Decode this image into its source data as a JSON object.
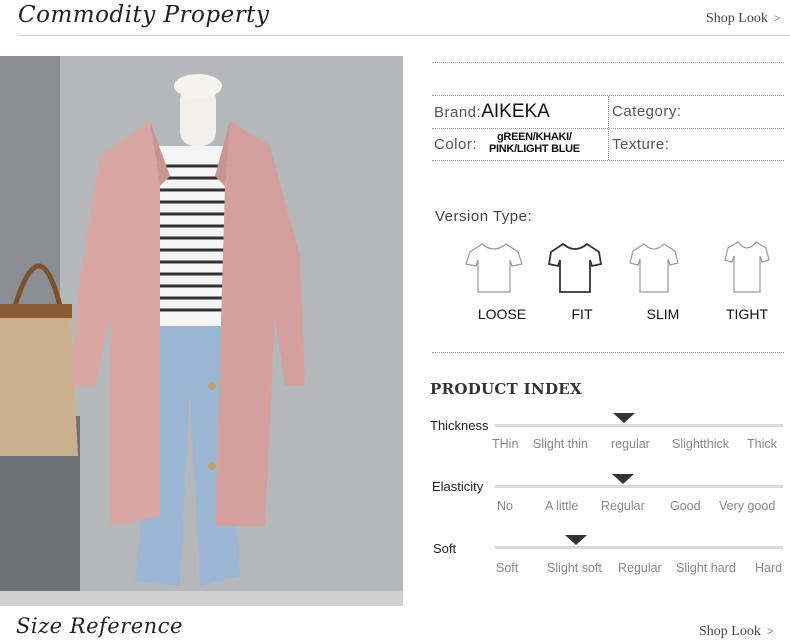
{
  "header": {
    "title": "Commodity Property",
    "shop_look": "Shop Look",
    "chevron": ">"
  },
  "footer": {
    "title": "Size Reference",
    "shop_look": "Shop Look",
    "chevron": ">"
  },
  "specs": {
    "brand_label": "Brand:",
    "brand_value": "AIKEKA",
    "category_label": "Category:",
    "color_label": "Color:",
    "color_value_line1": "gREEN/KHAKI/",
    "color_value_line2": "PINK/LIGHT BLUE",
    "texture_label": "Texture:"
  },
  "version": {
    "title": "Version Type:",
    "types": [
      "LOOSE",
      "FIT",
      "SLIM",
      "TIGHT"
    ],
    "selected": "FIT"
  },
  "product_index": {
    "title": "PRODUCT INDEX",
    "metrics": [
      {
        "label": "Thickness",
        "scale": [
          "THin",
          "Slight thin",
          "regular",
          "Slightthick",
          "Thick"
        ],
        "selected": "regular"
      },
      {
        "label": "Elasticity",
        "scale": [
          "No",
          "A little",
          "Regular",
          "Good",
          "Very good"
        ],
        "selected": "Regular"
      },
      {
        "label": "Soft",
        "scale": [
          "Soft",
          "Slight soft",
          "Regular",
          "Slight hard",
          "Hard"
        ],
        "selected": "Slight soft"
      }
    ]
  },
  "colors": {
    "coat": "#d9a6a4",
    "marker": "#333333"
  },
  "icons": {
    "shirt": "t-shirt-icon",
    "marker": "triangle-marker-icon"
  }
}
